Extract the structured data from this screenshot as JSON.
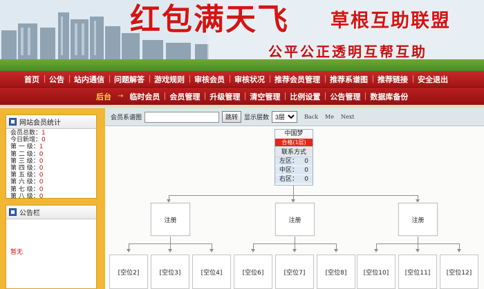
{
  "banner": {
    "title": "红包满天飞",
    "title2": "草根互助联盟",
    "slogan": "公平公正透明互帮互助"
  },
  "nav_main": [
    "首页",
    "公告",
    "站内通信",
    "问题解答",
    "游戏规则",
    "审核会员",
    "审核状况",
    "推荐会员管理",
    "推荐系谱图",
    "推荐链接",
    "安全退出"
  ],
  "nav_admin": {
    "active": "后台",
    "arrow": "→",
    "items": [
      "临时会员",
      "会员管理",
      "升级管理",
      "清空管理",
      "比例设置",
      "公告管理",
      "数据库备份"
    ]
  },
  "sidebar": {
    "stats_title": "网站会员统计",
    "stats": [
      {
        "label": "会员总数：",
        "value": "1"
      },
      {
        "label": "今日新增：",
        "value": "0"
      },
      {
        "label": "第 一 级：",
        "value": "1"
      },
      {
        "label": "第 二 级：",
        "value": "0"
      },
      {
        "label": "第 三 级：",
        "value": "0"
      },
      {
        "label": "第 四 级：",
        "value": "0"
      },
      {
        "label": "第 五 级：",
        "value": "0"
      },
      {
        "label": "第 六 级：",
        "value": "0"
      },
      {
        "label": "第 七 级：",
        "value": "0"
      },
      {
        "label": "第 八 级：",
        "value": "0"
      }
    ],
    "notice_title": "公告栏",
    "notice_text": "暂无"
  },
  "toolbar": {
    "label": "会员系谱图",
    "search_value": "",
    "jump_button": "跳转",
    "levels_label": "显示层数",
    "levels_value": "3层",
    "back": "Back",
    "me": "Me",
    "next": "Next"
  },
  "tree": {
    "root": {
      "name": "中国梦",
      "level": "合格(1层)",
      "contact": "联系方式",
      "zones": [
        {
          "label": "左区：",
          "value": "0"
        },
        {
          "label": "中区：",
          "value": "0"
        },
        {
          "label": "右区：",
          "value": "0"
        }
      ]
    },
    "children": [
      "注册",
      "注册",
      "注册"
    ],
    "leaves": [
      "[空位2]",
      "[空位3]",
      "[空位4]",
      "[空位6]",
      "[空位7]",
      "[空位8]",
      "[空位10]",
      "[空位11]",
      "[空位12]"
    ]
  }
}
